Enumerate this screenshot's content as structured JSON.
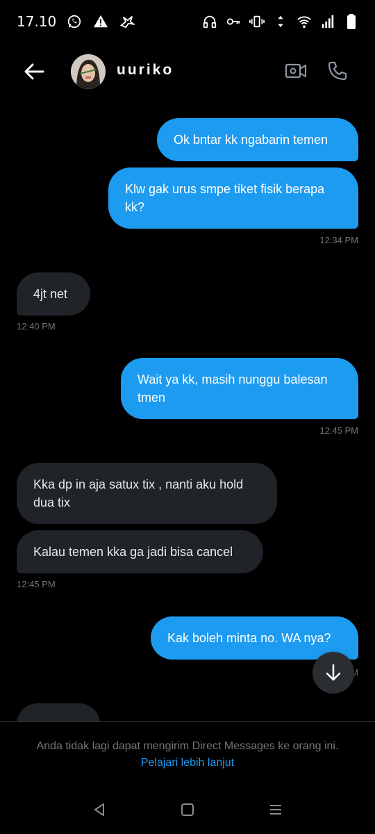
{
  "status_bar": {
    "time": "17.10",
    "left_icons": [
      "whatsapp-icon",
      "warning-icon",
      "bird-icon"
    ],
    "right_icons": [
      "headphones-icon",
      "key-icon",
      "vibrate-icon",
      "data-arrows-icon",
      "wifi-icon",
      "signal-icon",
      "battery-icon"
    ]
  },
  "header": {
    "username": "uuriko"
  },
  "messages": [
    {
      "dir": "out",
      "text": "Ok bntar kk ngabarin temen"
    },
    {
      "dir": "out",
      "text": "Klw gak urus smpe tiket fisik berapa kk?",
      "time": "12:34 PM"
    },
    {
      "dir": "in",
      "text": "4jt net",
      "time": "12:40 PM"
    },
    {
      "dir": "out",
      "text": "Wait ya kk, masih nunggu balesan tmen",
      "time": "12:45 PM"
    },
    {
      "dir": "in",
      "text": "Kka dp in aja satux tix , nanti aku hold dua tix"
    },
    {
      "dir": "in",
      "text": "Kalau temen kka ga jadi bisa cancel",
      "time": "12:45 PM"
    },
    {
      "dir": "out",
      "text": "Kak boleh minta no. WA nya?"
    }
  ],
  "notice": {
    "text": "Anda tidak lagi dapat mengirim Direct Messages ke orang ini.",
    "link": "Pelajari lebih lanjut"
  },
  "navbar": {
    "buttons": [
      "back-triangle-icon",
      "home-square-icon",
      "recents-menu-icon"
    ]
  },
  "colors": {
    "outgoing_bubble": "#1d9bf0",
    "incoming_bubble": "#202327",
    "background": "#000000",
    "link": "#1d9bf0"
  }
}
